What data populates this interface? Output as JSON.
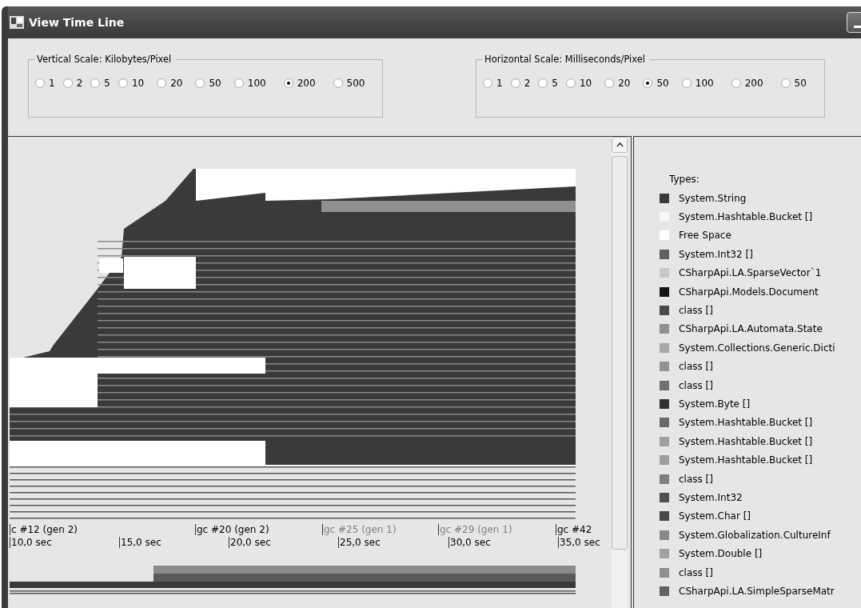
{
  "window": {
    "title": "View Time Line"
  },
  "vertical_scale": {
    "label": "Vertical Scale: Kilobytes/Pixel",
    "options": [
      {
        "label": "1",
        "selected": false
      },
      {
        "label": "2",
        "selected": false
      },
      {
        "label": "5",
        "selected": false
      },
      {
        "label": "10",
        "selected": false
      },
      {
        "label": "20",
        "selected": false
      },
      {
        "label": "50",
        "selected": false
      },
      {
        "label": "100",
        "selected": false
      },
      {
        "label": "200",
        "selected": true
      },
      {
        "label": "500",
        "selected": false
      }
    ]
  },
  "horizontal_scale": {
    "label": "Horizontal Scale: Milliseconds/Pixel",
    "options": [
      {
        "label": "1",
        "selected": false
      },
      {
        "label": "2",
        "selected": false
      },
      {
        "label": "5",
        "selected": false
      },
      {
        "label": "10",
        "selected": false
      },
      {
        "label": "20",
        "selected": false
      },
      {
        "label": "50",
        "selected": true
      },
      {
        "label": "100",
        "selected": false
      },
      {
        "label": "200",
        "selected": false
      },
      {
        "label": "50",
        "selected": false
      }
    ]
  },
  "timeline": {
    "gc_marks": [
      {
        "label": "c #12 (gen 2)",
        "color": "#000000"
      },
      {
        "label": "gc #20 (gen 2)",
        "color": "#000000"
      },
      {
        "label": "gc #25 (gen 1)",
        "color": "#808080"
      },
      {
        "label": "gc #29 (gen 1)",
        "color": "#808080"
      },
      {
        "label": "gc #42",
        "color": "#000000"
      }
    ],
    "time_labels": [
      "10,0 sec",
      "15,0 sec",
      "20,0 sec",
      "25,0 sec",
      "30,0 sec",
      "35,0 sec"
    ]
  },
  "legend": {
    "title": "Types:",
    "items": [
      {
        "label": "System.String",
        "color": "#3a3a3a"
      },
      {
        "label": "System.Hashtable.Bucket []",
        "color": "#f7f7f7"
      },
      {
        "label": "Free Space",
        "color": "#ffffff"
      },
      {
        "label": "System.Int32 []",
        "color": "#606060"
      },
      {
        "label": "CSharpApi.LA.SparseVector`1",
        "color": "#c8c8c8"
      },
      {
        "label": "CSharpApi.Models.Document",
        "color": "#151515"
      },
      {
        "label": "class []",
        "color": "#4a4a4a"
      },
      {
        "label": "CSharpApi.LA.Automata.State",
        "color": "#909090"
      },
      {
        "label": "System.Collections.Generic.Dicti",
        "color": "#a8a8a8"
      },
      {
        "label": "class []",
        "color": "#929292"
      },
      {
        "label": "class []",
        "color": "#707070"
      },
      {
        "label": "System.Byte []",
        "color": "#303030"
      },
      {
        "label": "System.Hashtable.Bucket []",
        "color": "#6a6a6a"
      },
      {
        "label": "System.Hashtable.Bucket []",
        "color": "#a0a0a0"
      },
      {
        "label": "System.Hashtable.Bucket []",
        "color": "#9e9e9e"
      },
      {
        "label": "class []",
        "color": "#808080"
      },
      {
        "label": "System.Int32",
        "color": "#505050"
      },
      {
        "label": "System.Char []",
        "color": "#484848"
      },
      {
        "label": "System.Globalization.CultureInf",
        "color": "#888888"
      },
      {
        "label": "System.Double []",
        "color": "#a2a2a2"
      },
      {
        "label": "class []",
        "color": "#8e8e8e"
      },
      {
        "label": "CSharpApi.LA.SimpleSparseMatr",
        "color": "#626262"
      }
    ]
  }
}
